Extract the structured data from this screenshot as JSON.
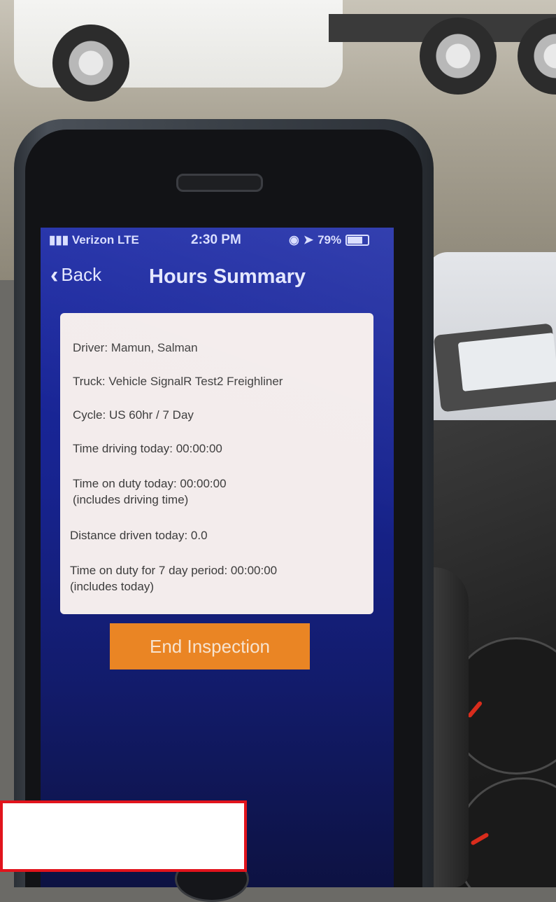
{
  "status_bar": {
    "carrier": "Verizon  LTE",
    "time": "2:30 PM",
    "battery": "79%",
    "battery_level": 0.79,
    "icons": [
      "signal-bars-icon",
      "location-arrow-icon",
      "alarm-icon",
      "battery-icon"
    ]
  },
  "nav": {
    "back_label": "Back",
    "back_icon": "chevron-left-icon",
    "title": "Hours Summary"
  },
  "summary": {
    "driver": "Driver:  Mamun, Salman",
    "truck": "Truck: Vehicle SignalR Test2 Freighliner",
    "cycle": "Cycle: US 60hr / 7 Day",
    "time_driving": "Time driving today: 00:00:00",
    "time_on_duty": "Time on duty today: 00:00:00",
    "time_on_duty_note": "(includes driving time)",
    "distance": "Distance driven today: 0.0",
    "time_7day": "Time on duty for 7 day period: 00:00:00",
    "time_7day_note": "(includes today)"
  },
  "actions": {
    "end_inspection": "End Inspection"
  },
  "colors": {
    "screen_bg": "#1c2aa6",
    "card_bg": "#f3ecec",
    "button_bg": "#ea8524",
    "annotation_border": "#e1141c"
  }
}
